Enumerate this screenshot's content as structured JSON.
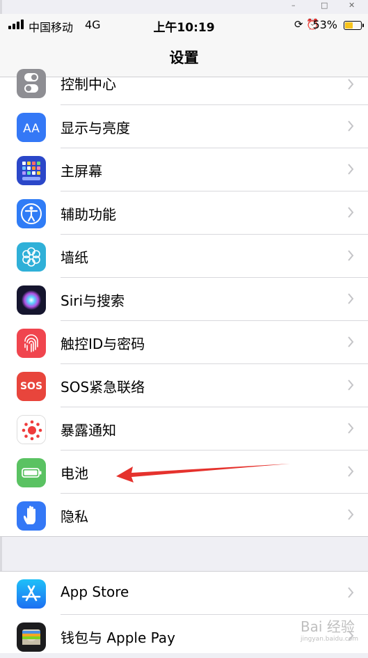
{
  "window_controls": {
    "minimize": "–",
    "maximize": "□",
    "close": "✕"
  },
  "status_bar": {
    "carrier": "中国移动",
    "network": "4G",
    "time": "上午10:19",
    "status_glyphs": "⟳ ⏰",
    "battery_percent": "53%",
    "battery_level": 0.53,
    "battery_color": "#f7c31c"
  },
  "nav": {
    "title": "设置"
  },
  "settings_group_1": [
    {
      "label": "控制中心",
      "icon": "control-center-icon",
      "color": "#8e8e93"
    },
    {
      "label": "显示与亮度",
      "icon": "display-brightness-icon",
      "color": "#3478f6"
    },
    {
      "label": "主屏幕",
      "icon": "home-screen-icon",
      "color": "#3366e0"
    },
    {
      "label": "辅助功能",
      "icon": "accessibility-icon",
      "color": "#2f7cf6"
    },
    {
      "label": "墙纸",
      "icon": "wallpaper-icon",
      "color": "#2fb0d8"
    },
    {
      "label": "Siri与搜索",
      "icon": "siri-icon",
      "color": "#222244"
    },
    {
      "label": "触控ID与密码",
      "icon": "touch-id-icon",
      "color": "#f0454e"
    },
    {
      "label": "SOS紧急联络",
      "icon": "sos-icon",
      "color": "#e8453c"
    },
    {
      "label": "暴露通知",
      "icon": "exposure-notification-icon",
      "color": "#ffffff"
    },
    {
      "label": "电池",
      "icon": "battery-icon",
      "color": "#5ac262"
    },
    {
      "label": "隐私",
      "icon": "privacy-hand-icon",
      "color": "#3478f6"
    }
  ],
  "settings_group_2": [
    {
      "label": "App Store",
      "icon": "app-store-icon",
      "color": "#2d8cf0"
    },
    {
      "label": "钱包与 Apple Pay",
      "icon": "wallet-icon",
      "color": "#1c1c1e"
    }
  ],
  "sos_icon_text": "SOS",
  "annotation": {
    "arrow_color": "#e5322d"
  },
  "watermark": {
    "main": "Bai 经验",
    "sub": "jingyan.baidu.com"
  }
}
